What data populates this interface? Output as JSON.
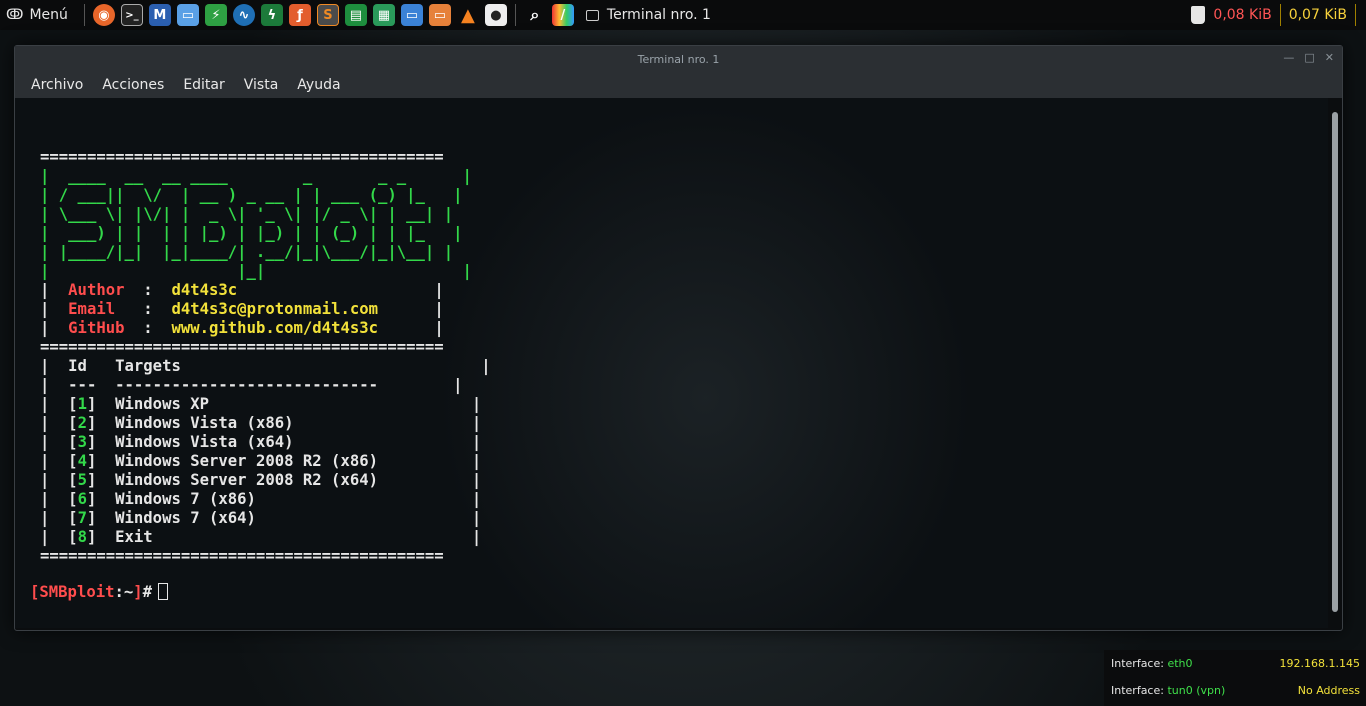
{
  "panel": {
    "menu_label": "Menú",
    "task_title": "Terminal nro. 1",
    "net_down": "0,08 KiB",
    "net_up": "0,07 KiB",
    "launchers": [
      "firefox-icon",
      "terminal-icon",
      "metasploit-icon",
      "files-icon",
      "torrent-icon",
      "wireshark-icon",
      "kali-tool-icon",
      "burp-icon",
      "sublime-icon",
      "sheets-icon",
      "docs-icon",
      "writer-icon",
      "impress-icon",
      "vlc-icon",
      "screen-recorder-icon"
    ]
  },
  "window": {
    "title": "Terminal nro. 1",
    "menu": [
      "Archivo",
      "Acciones",
      "Editar",
      "Vista",
      "Ayuda"
    ]
  },
  "terminal": {
    "banner": {
      "border": "===========================================",
      "art": [
        "|  ____  __  __ ____        _       _ _      |",
        "| / ___||  \\/  | __ ) _ __ | | ___ (_) |_   |",
        "| \\___ \\| |\\/| |  _ \\| '_ \\| |/ _ \\| | __| |",
        "|  ___) | |  | | |_) | |_) | | (_) | | |_   |",
        "| |____/|_|  |_|____/| .__/|_|\\___/|_|\\__| |",
        "|                    |_|                     |"
      ],
      "info": [
        {
          "key": "Author",
          "value": "d4t4s3c"
        },
        {
          "key": "Email",
          "value": "d4t4s3c@protonmail.com"
        },
        {
          "key": "GitHub",
          "value": "www.github.com/d4t4s3c"
        }
      ]
    },
    "table": {
      "headers": [
        "Id",
        "Targets"
      ],
      "rule": [
        "---",
        "----------------------------"
      ],
      "rows": [
        {
          "id": "1",
          "target": "Windows XP"
        },
        {
          "id": "2",
          "target": "Windows Vista (x86)"
        },
        {
          "id": "3",
          "target": "Windows Vista (x64)"
        },
        {
          "id": "4",
          "target": "Windows Server 2008 R2 (x86)"
        },
        {
          "id": "5",
          "target": "Windows Server 2008 R2 (x64)"
        },
        {
          "id": "6",
          "target": "Windows 7 (x86)"
        },
        {
          "id": "7",
          "target": "Windows 7 (x64)"
        },
        {
          "id": "8",
          "target": "Exit"
        }
      ]
    },
    "prompt": {
      "open": "[",
      "name": "SMBploit",
      "sep": ":",
      "path": "~",
      "close": "]",
      "sym": "#"
    }
  },
  "conky": {
    "label": "Interface:",
    "rows": [
      {
        "iface": "eth0",
        "addr": "192.168.1.145"
      },
      {
        "iface": "tun0 (vpn)",
        "addr": "No Address"
      }
    ]
  },
  "colors": {
    "accent_green": "#33d84a",
    "accent_red": "#ff4d4d",
    "accent_yellow": "#f2e13a"
  }
}
